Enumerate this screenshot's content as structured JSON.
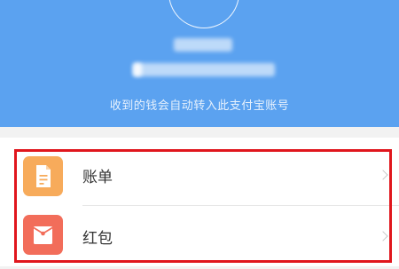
{
  "header": {
    "note": "收到的钱会自动转入此支付宝账号"
  },
  "menu": {
    "items": [
      {
        "label": "账单",
        "icon": "bill-icon"
      },
      {
        "label": "红包",
        "icon": "red-envelope-icon"
      }
    ]
  },
  "colors": {
    "header_bg": "#5ba2f0",
    "bill_icon": "#f7ab5b",
    "hongbao_icon": "#f26d5a",
    "highlight": "#e0161d"
  }
}
